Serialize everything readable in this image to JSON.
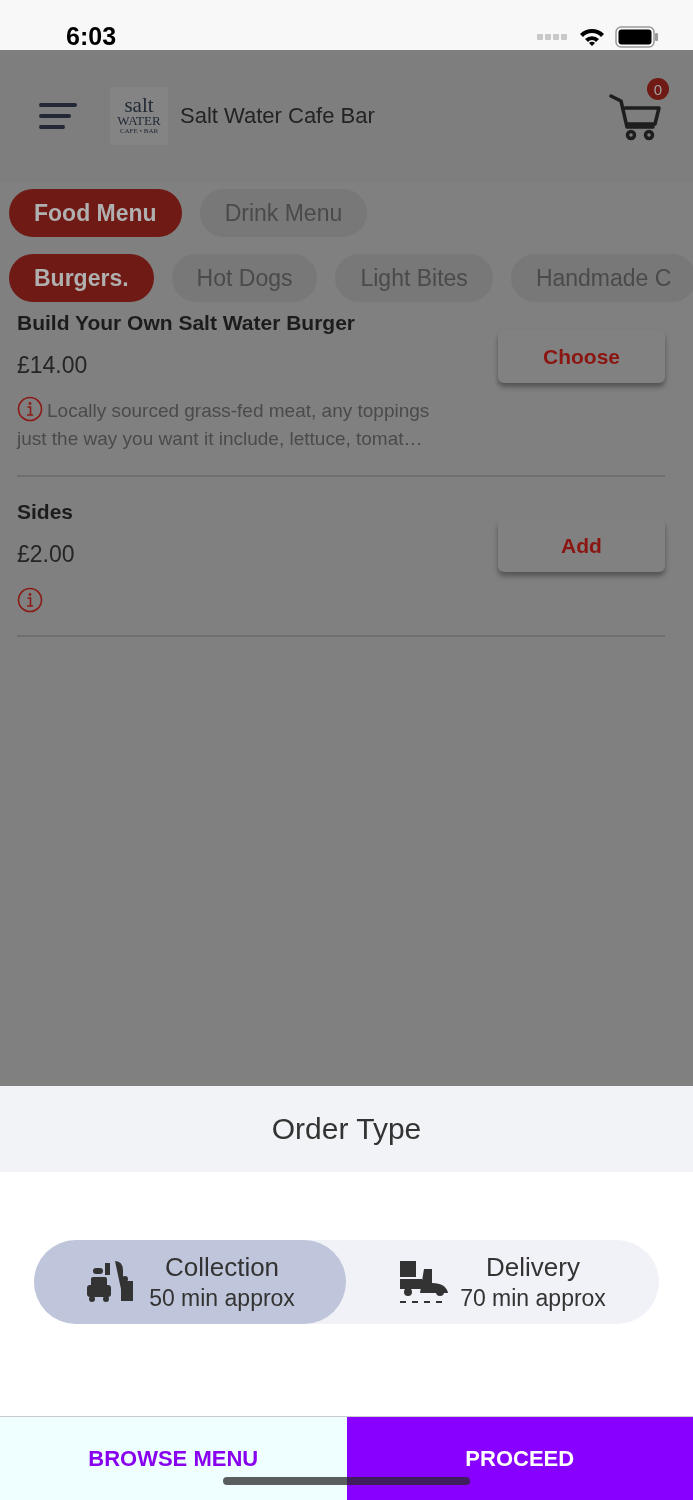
{
  "status_bar": {
    "time": "6:03"
  },
  "header": {
    "logo": {
      "top": "salt",
      "middle": "WATER",
      "bottom": "CAFE • BAR"
    },
    "title": "Salt Water Cafe Bar",
    "cart_count": "0"
  },
  "menu_tabs": [
    {
      "label": "Food Menu",
      "selected": true
    },
    {
      "label": "Drink Menu",
      "selected": false
    }
  ],
  "categories": [
    {
      "label": "Burgers.",
      "selected": true
    },
    {
      "label": "Hot Dogs",
      "selected": false
    },
    {
      "label": "Light Bites",
      "selected": false
    },
    {
      "label": "Handmade C",
      "selected": false
    }
  ],
  "items": [
    {
      "name": "Build Your Own Salt Water Burger",
      "price": "£14.00",
      "description": "Locally sourced grass-fed meat, any toppings just the way you want it include, lettuce, tomat…",
      "button": "Choose"
    },
    {
      "name": "Sides",
      "price": "£2.00",
      "button": "Add"
    }
  ],
  "order_type": {
    "title": "Order Type",
    "options": [
      {
        "kind": "collection",
        "label": "Collection",
        "time": "50 min approx",
        "selected": true
      },
      {
        "kind": "delivery",
        "label": "Delivery",
        "time": "70 min approx",
        "selected": false
      }
    ]
  },
  "actions": [
    {
      "kind": "secondary",
      "label": "BROWSE MENU"
    },
    {
      "kind": "primary",
      "label": "PROCEED"
    }
  ]
}
